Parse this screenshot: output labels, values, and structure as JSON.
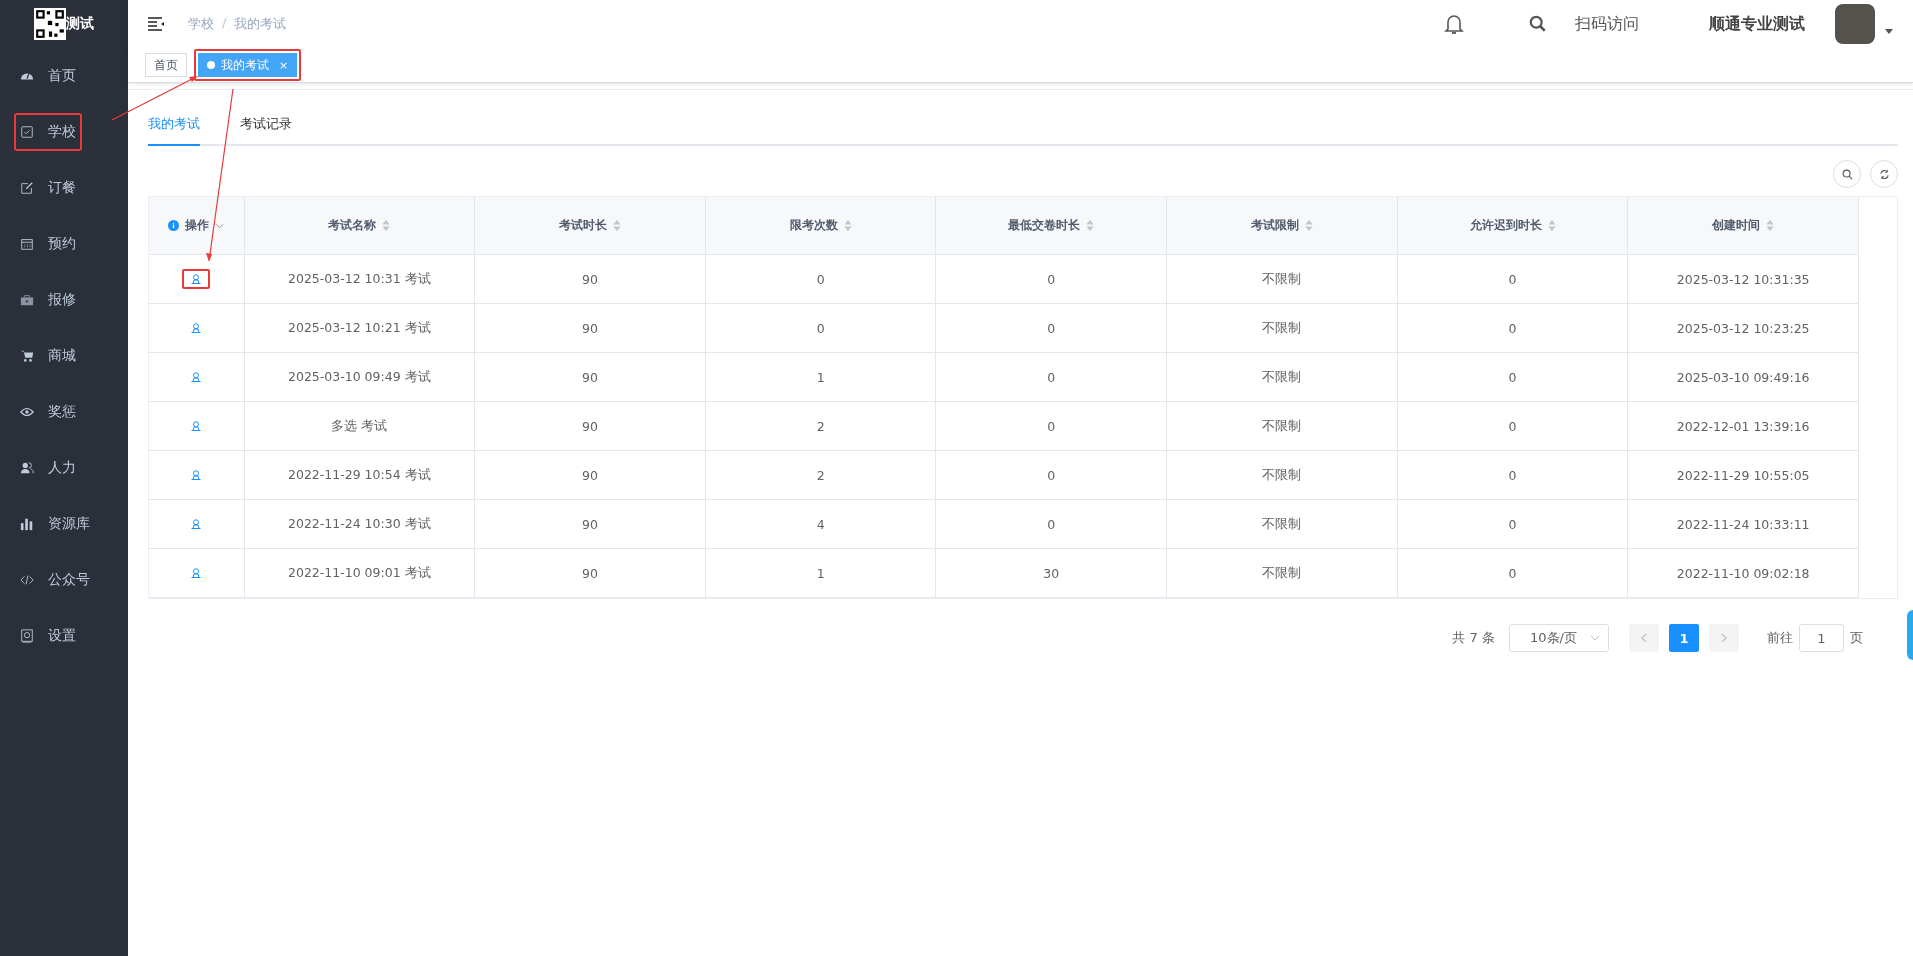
{
  "sidebar": {
    "logo_text": "测试",
    "items": [
      {
        "label": "首页",
        "annotated": false
      },
      {
        "label": "学校",
        "annotated": true
      },
      {
        "label": "订餐",
        "annotated": false
      },
      {
        "label": "预约",
        "annotated": false
      },
      {
        "label": "报修",
        "annotated": false
      },
      {
        "label": "商城",
        "annotated": false
      },
      {
        "label": "奖惩",
        "annotated": false
      },
      {
        "label": "人力",
        "annotated": false
      },
      {
        "label": "资源库",
        "annotated": false
      },
      {
        "label": "公众号",
        "annotated": false
      },
      {
        "label": "设置",
        "annotated": false
      }
    ]
  },
  "header": {
    "breadcrumb": [
      "学校",
      "我的考试"
    ],
    "separator": "/",
    "scan_label": "扫码访问",
    "user_name": "顺通专业测试"
  },
  "tags": [
    {
      "label": "首页",
      "selected": false,
      "annotated": false
    },
    {
      "label": "我的考试",
      "selected": true,
      "annotated": true,
      "close": "×"
    }
  ],
  "content_tabs": [
    {
      "label": "我的考试",
      "selected": true
    },
    {
      "label": "考试记录",
      "selected": false
    }
  ],
  "table": {
    "columns": [
      {
        "label": "操作",
        "kind": "action"
      },
      {
        "label": "考试名称",
        "kind": "sortable"
      },
      {
        "label": "考试时长",
        "kind": "sortable"
      },
      {
        "label": "限考次数",
        "kind": "sortable"
      },
      {
        "label": "最低交卷时长",
        "kind": "sortable"
      },
      {
        "label": "考试限制",
        "kind": "sortable"
      },
      {
        "label": "允许迟到时长",
        "kind": "sortable"
      },
      {
        "label": "创建时间",
        "kind": "sortable"
      }
    ],
    "rows": [
      {
        "annotated": true,
        "cells": [
          "",
          "2025-03-12 10:31 考试",
          "90",
          "0",
          "0",
          "不限制",
          "0",
          "2025-03-12 10:31:35"
        ]
      },
      {
        "annotated": false,
        "cells": [
          "",
          "2025-03-12 10:21 考试",
          "90",
          "0",
          "0",
          "不限制",
          "0",
          "2025-03-12 10:23:25"
        ]
      },
      {
        "annotated": false,
        "cells": [
          "",
          "2025-03-10 09:49 考试",
          "90",
          "1",
          "0",
          "不限制",
          "0",
          "2025-03-10 09:49:16"
        ]
      },
      {
        "annotated": false,
        "cells": [
          "",
          "多选 考试",
          "90",
          "2",
          "0",
          "不限制",
          "0",
          "2022-12-01 13:39:16"
        ]
      },
      {
        "annotated": false,
        "cells": [
          "",
          "2022-11-29 10:54 考试",
          "90",
          "2",
          "0",
          "不限制",
          "0",
          "2022-11-29 10:55:05"
        ]
      },
      {
        "annotated": false,
        "cells": [
          "",
          "2022-11-24 10:30 考试",
          "90",
          "4",
          "0",
          "不限制",
          "0",
          "2022-11-24 10:33:11"
        ]
      },
      {
        "annotated": false,
        "cells": [
          "",
          "2022-11-10 09:01 考试",
          "90",
          "1",
          "30",
          "不限制",
          "0",
          "2022-11-10 09:02:18"
        ]
      }
    ]
  },
  "pagination": {
    "total": "共 7 条",
    "page_size": "10条/页",
    "pages": [
      {
        "label": "1",
        "selected": true
      }
    ],
    "goto_label": "前往",
    "goto_value": "1",
    "page_unit": "页"
  }
}
